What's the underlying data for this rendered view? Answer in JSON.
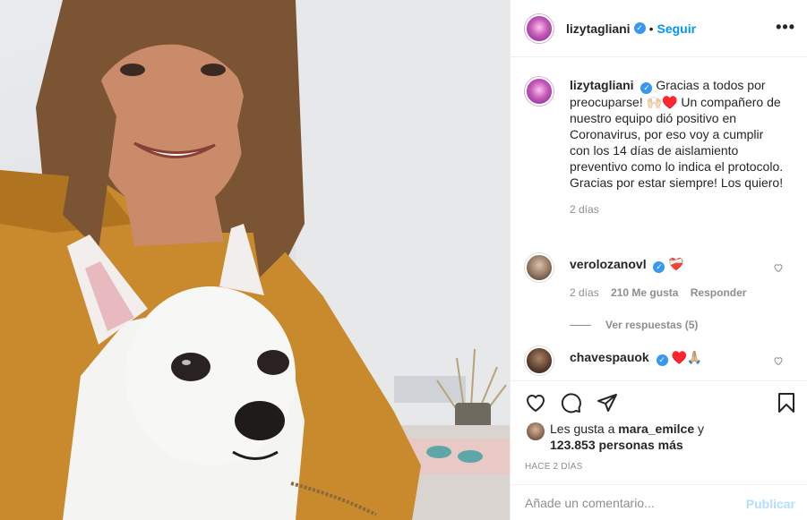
{
  "post": {
    "author": "lizytagliani",
    "follow_label": "Seguir",
    "separator": "•",
    "more_label": "•••",
    "verified_mark": "✓",
    "caption_text": "Gracias a todos por preocuparse! 🙌🏻♥️ Un compañero de nuestro equipo dió positivo en Coronavirus, por eso voy a cumplir con los 14 días de aislamiento preventivo como lo indica el protocolo. Gracias por estar siempre! Los quiero!",
    "caption_time": "2 días"
  },
  "comments": [
    {
      "user": "verolozanovl",
      "text": "❤️‍🩹",
      "time": "2 días",
      "likes": "210 Me gusta",
      "reply_label": "Responder",
      "view_replies": "Ver respuestas (5)"
    },
    {
      "user": "chavespauok",
      "text": "♥️🙏🏼"
    }
  ],
  "likes_summary": {
    "prefix": "Les gusta a",
    "user": "mara_emilce",
    "joiner": "y",
    "count": "123.853 personas más"
  },
  "time_ago": "HACE 2 DÍAS",
  "add_comment": {
    "placeholder": "Añade un comentario...",
    "publish_label": "Publicar"
  },
  "icons": {
    "like": "heart-icon",
    "comment": "comment-icon",
    "share": "share-icon",
    "save": "bookmark-icon",
    "comment_like": "heart-icon",
    "options": "ellipsis-icon"
  },
  "colors": {
    "accent": "#0095f6",
    "verified": "#3897f0",
    "muted": "#8e8e8e",
    "text": "#262626",
    "publish_disabled": "#b2dffc"
  }
}
